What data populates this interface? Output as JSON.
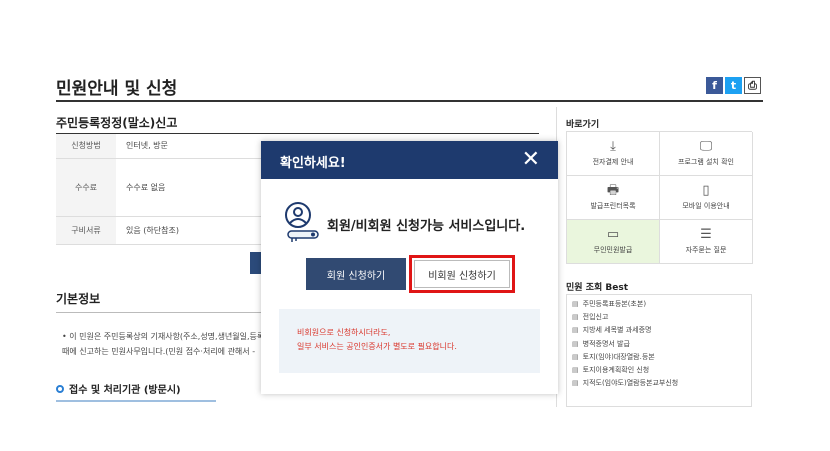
{
  "page": {
    "title": "민원안내 및 신청",
    "share": {
      "facebook": "f",
      "twitter": "t",
      "print": "⎙"
    }
  },
  "service": {
    "title": "주민등록정정(말소)신고",
    "rows": [
      {
        "label": "신청방법",
        "value": "인터넷, 방문"
      },
      {
        "label": "수수료",
        "value": "수수료 없음"
      },
      {
        "label": "구비서류",
        "value": "있음 (하단참조)"
      }
    ]
  },
  "basic": {
    "title": "기본정보",
    "lines": [
      "• 이 민원은 주민등록상의 기재사항(주소,성명,생년월일,등록기",
      "   때에 신고하는 민원사무입니다.(민원 접수·처리에 관해서 -"
    ],
    "intake_title": "접수 및 처리기관 (방문시)"
  },
  "quick": {
    "title": "바로가기",
    "items": [
      {
        "label": "전자결제 안내",
        "icon": "download-icon",
        "glyph": "⤓"
      },
      {
        "label": "프로그램 설치 확인",
        "icon": "monitor-check-icon",
        "glyph": "🖵"
      },
      {
        "label": "발급프린터목록",
        "icon": "printer-icon",
        "glyph": "🖶"
      },
      {
        "label": "모바일 이용안내",
        "icon": "mobile-icon",
        "glyph": "▯"
      },
      {
        "label": "무인민원발급",
        "icon": "kiosk-icon",
        "glyph": "▭"
      },
      {
        "label": "자주묻는 질문",
        "icon": "faq-chat-icon",
        "glyph": "☰"
      }
    ],
    "highlight_color": "#eaf6dd"
  },
  "best": {
    "title": "민원 조회 Best",
    "items": [
      "주민등록표등본(초본)",
      "전입신고",
      "지방세 세목별 과세증명",
      "병적증명서 발급",
      "토지(임야)대장열람.등본",
      "토지이용계획확인 신청",
      "지적도(임야도)열람등본교부신청"
    ]
  },
  "modal": {
    "title": "확인하세요!",
    "close": "✕",
    "message": "회원/비회원 신청가능 서비스입니다.",
    "member_button": "회원 신청하기",
    "nonmember_button": "비회원 신청하기",
    "notice_line1": "비회원으로 신청하시더라도,",
    "notice_line2": "일부 서비스는 공인인증서가 별도로 필요합니다.",
    "header_color": "#1e3a6e",
    "highlight_border": "#e01515"
  }
}
